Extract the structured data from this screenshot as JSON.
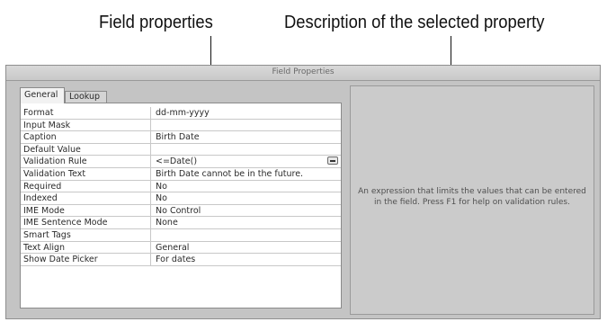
{
  "callouts": {
    "field_properties": "Field properties",
    "description": "Description of the selected property"
  },
  "panel": {
    "title": "Field Properties",
    "tabs": [
      {
        "label": "General",
        "selected": true
      },
      {
        "label": "Lookup",
        "selected": false
      }
    ],
    "properties": [
      {
        "name": "Format",
        "value": "dd-mm-yyyy"
      },
      {
        "name": "Input Mask",
        "value": ""
      },
      {
        "name": "Caption",
        "value": "Birth Date"
      },
      {
        "name": "Default Value",
        "value": ""
      },
      {
        "name": "Validation Rule",
        "value": "<=Date()"
      },
      {
        "name": "Validation Text",
        "value": "Birth Date cannot be in the future."
      },
      {
        "name": "Required",
        "value": "No"
      },
      {
        "name": "Indexed",
        "value": "No"
      },
      {
        "name": "IME Mode",
        "value": "No Control"
      },
      {
        "name": "IME Sentence Mode",
        "value": "None"
      },
      {
        "name": "Smart Tags",
        "value": ""
      },
      {
        "name": "Text Align",
        "value": "General"
      },
      {
        "name": "Show Date Picker",
        "value": "For dates"
      }
    ],
    "builder_icon": "ellipsis-builder-icon",
    "description": "An expression that limits the values that can be entered in the field.  Press F1 for help on validation rules."
  }
}
